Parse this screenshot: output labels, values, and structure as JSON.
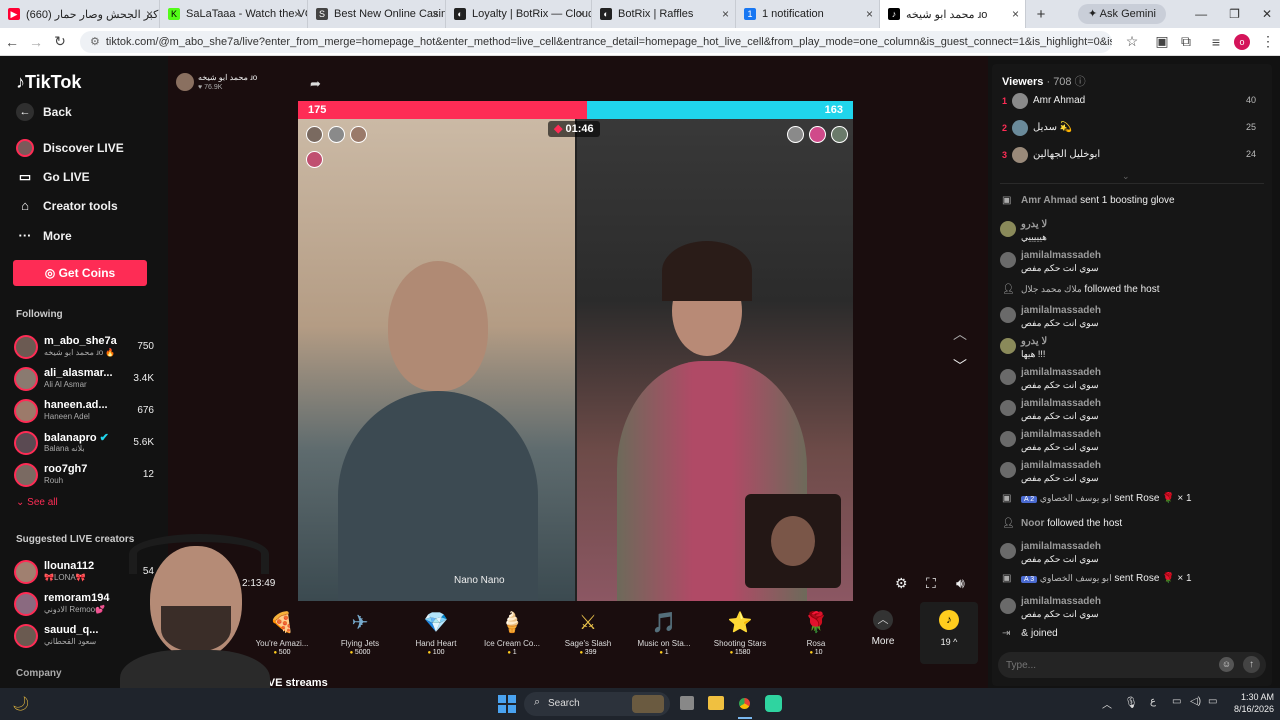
{
  "browser": {
    "tabs": [
      {
        "title": "(660) كبر الجحش وصار حمار",
        "fav_color": "#ff0033",
        "fav": "▶"
      },
      {
        "title": "SaLaTaaa - Watch the VOD",
        "fav_color": "#53fc18",
        "fav": "K"
      },
      {
        "title": "Best New Online Casino",
        "fav_color": "#444444",
        "fav": "S"
      },
      {
        "title": "Loyalty | BotRix — Cloud St",
        "fav_color": "#222222",
        "fav": "◐"
      },
      {
        "title": "BotRix | Raffles",
        "fav_color": "#222222",
        "fav": "◐"
      },
      {
        "title": "1 notification",
        "fav_color": "#1877f2",
        "fav": "1"
      },
      {
        "title": "محمد ابو شيخه ɹo",
        "fav_color": "#000000",
        "fav": "♪"
      }
    ],
    "ask_gemini": "Ask Gemini",
    "url": "tiktok.com/@m_abo_she7a/live?enter_from_merge=homepage_hot&enter_method=live_cell&entrance_detail=homepage_hot_live_cell&from_play_mode=one_column&is_guest_connect=1&is_highlight=0&is_landscape=0&load_position=29&..."
  },
  "sidebar": {
    "logo": "TikTok",
    "back": "Back",
    "items": [
      {
        "label": "Discover LIVE",
        "icon": "discover-icon"
      },
      {
        "label": "Go LIVE",
        "icon": "camera-icon"
      },
      {
        "label": "Creator tools",
        "icon": "home-icon"
      },
      {
        "label": "More",
        "icon": "more-icon"
      }
    ],
    "get_coins": "Get Coins",
    "following_title": "Following",
    "following": [
      {
        "name": "m_abo_she7a",
        "sub": "محمد ابو شيخه ɹo 🔥",
        "count": "750"
      },
      {
        "name": "ali_alasmar...",
        "sub": "Ali Al Asmar",
        "count": "3.4K"
      },
      {
        "name": "haneen.ad...",
        "sub": "Haneen Adel",
        "count": "676"
      },
      {
        "name": "balanapro",
        "sub": "Balana بلانه",
        "count": "5.6K"
      },
      {
        "name": "roo7gh7",
        "sub": "Rouh",
        "count": "12"
      }
    ],
    "see_all": "See all",
    "suggested_title": "Suggested LIVE creators",
    "suggested": [
      {
        "name": "llouna112",
        "sub": "🎀LONA🎀",
        "count": "54"
      },
      {
        "name": "remoram194",
        "sub": "الادوني Remoo💕",
        "count": ""
      },
      {
        "name": "sauud_q...",
        "sub": "سعود القحطاني",
        "count": ""
      }
    ],
    "company": "Company"
  },
  "stream": {
    "host_name": "محمد ابو شيخه ɹo",
    "host_likes": "76.9K",
    "pk_left_score": "175",
    "pk_right_score": "163",
    "pk_left_share": 0.52,
    "pk_timer": "01:46",
    "nano_label": "Nano Nano",
    "elapsed": "2:13:49",
    "more_live": "LIVE streams"
  },
  "gifts": [
    {
      "name": "You're Amazi...",
      "price": "500",
      "icon": "🍕"
    },
    {
      "name": "Flying Jets",
      "price": "5000",
      "icon": "✈"
    },
    {
      "name": "Hand Heart",
      "price": "100",
      "icon": "💎"
    },
    {
      "name": "Ice Cream Co...",
      "price": "1",
      "icon": "🍦"
    },
    {
      "name": "Sage's Slash",
      "price": "399",
      "icon": "⚔"
    },
    {
      "name": "Music on Sta...",
      "price": "1",
      "icon": "🎵"
    },
    {
      "name": "Shooting Stars",
      "price": "1580",
      "icon": "⭐"
    },
    {
      "name": "Rosa",
      "price": "10",
      "icon": "🌹"
    }
  ],
  "gift_more": "More",
  "coin_balance": "19",
  "viewers": {
    "title": "Viewers",
    "count": "708",
    "list": [
      {
        "rank": "1",
        "name": "Amr Ahmad",
        "score": "40"
      },
      {
        "rank": "2",
        "name": "سديل 💫",
        "score": "25"
      },
      {
        "rank": "3",
        "name": "ابوخليل الجهالين",
        "score": "24"
      }
    ]
  },
  "chat": [
    {
      "type": "event",
      "user": "Amr Ahmad",
      "text": "sent 1 boosting glove"
    },
    {
      "type": "msg",
      "user": "لا يدرو",
      "text": "هيييييي"
    },
    {
      "type": "msg",
      "user": "jamilalmassadeh",
      "text": "سوي انت حكم مفص"
    },
    {
      "type": "event",
      "user": "ملاك محمد جلال",
      "text": "followed the host"
    },
    {
      "type": "msg",
      "user": "jamilalmassadeh",
      "text": "سوي انت حكم مفص"
    },
    {
      "type": "msg",
      "user": "لا يدرو",
      "text": "هيها !!!"
    },
    {
      "type": "msg",
      "user": "jamilalmassadeh",
      "text": "سوي انت حكم مفص"
    },
    {
      "type": "msg",
      "user": "jamilalmassadeh",
      "text": "سوي انت حكم مفص"
    },
    {
      "type": "msg",
      "user": "jamilalmassadeh",
      "text": "سوي انت حكم مفص"
    },
    {
      "type": "msg",
      "user": "jamilalmassadeh",
      "text": "سوي انت حكم مفص"
    },
    {
      "type": "event",
      "user": "ابو يوسف الخصاوي",
      "text": "sent Rose 🌹 × 1"
    },
    {
      "type": "event",
      "user": "Noor",
      "text": "followed the host"
    },
    {
      "type": "msg",
      "user": "jamilalmassadeh",
      "text": "سوي انت حكم مفص"
    },
    {
      "type": "event",
      "user": "ابو يوسف الخصاوي",
      "text": "sent Rose 🌹 × 1"
    },
    {
      "type": "msg",
      "user": "jamilalmassadeh",
      "text": "سوي انت حكم مفص"
    },
    {
      "type": "event",
      "user": "&",
      "text": "joined"
    }
  ],
  "chat_placeholder": "Type...",
  "taskbar": {
    "search": "Search",
    "time": "1:30 AM",
    "date": "8/16/2026",
    "lang": "ع"
  }
}
